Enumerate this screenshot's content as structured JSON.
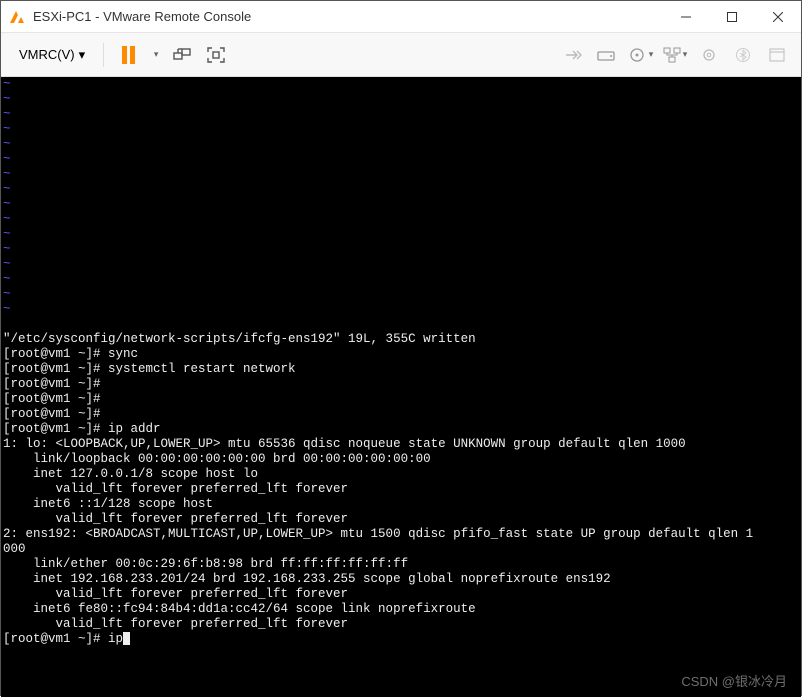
{
  "window": {
    "title": "ESXi-PC1 - VMware Remote Console"
  },
  "toolbar": {
    "menu_label": "VMRC(V)"
  },
  "terminal": {
    "tilde_rows": 16,
    "lines": [
      "\"/etc/sysconfig/network-scripts/ifcfg-ens192\" 19L, 355C written",
      "[root@vm1 ~]# sync",
      "[root@vm1 ~]# systemctl restart network",
      "[root@vm1 ~]#",
      "[root@vm1 ~]#",
      "[root@vm1 ~]#",
      "[root@vm1 ~]# ip addr",
      "1: lo: <LOOPBACK,UP,LOWER_UP> mtu 65536 qdisc noqueue state UNKNOWN group default qlen 1000",
      "    link/loopback 00:00:00:00:00:00 brd 00:00:00:00:00:00",
      "    inet 127.0.0.1/8 scope host lo",
      "       valid_lft forever preferred_lft forever",
      "    inet6 ::1/128 scope host",
      "       valid_lft forever preferred_lft forever",
      "2: ens192: <BROADCAST,MULTICAST,UP,LOWER_UP> mtu 1500 qdisc pfifo_fast state UP group default qlen 1",
      "000",
      "    link/ether 00:0c:29:6f:b8:98 brd ff:ff:ff:ff:ff:ff",
      "    inet 192.168.233.201/24 brd 192.168.233.255 scope global noprefixroute ens192",
      "       valid_lft forever preferred_lft forever",
      "    inet6 fe80::fc94:84b4:dd1a:cc42/64 scope link noprefixroute",
      "       valid_lft forever preferred_lft forever"
    ],
    "current_prompt": "[root@vm1 ~]# ip"
  },
  "watermark": "CSDN @银冰冷月"
}
